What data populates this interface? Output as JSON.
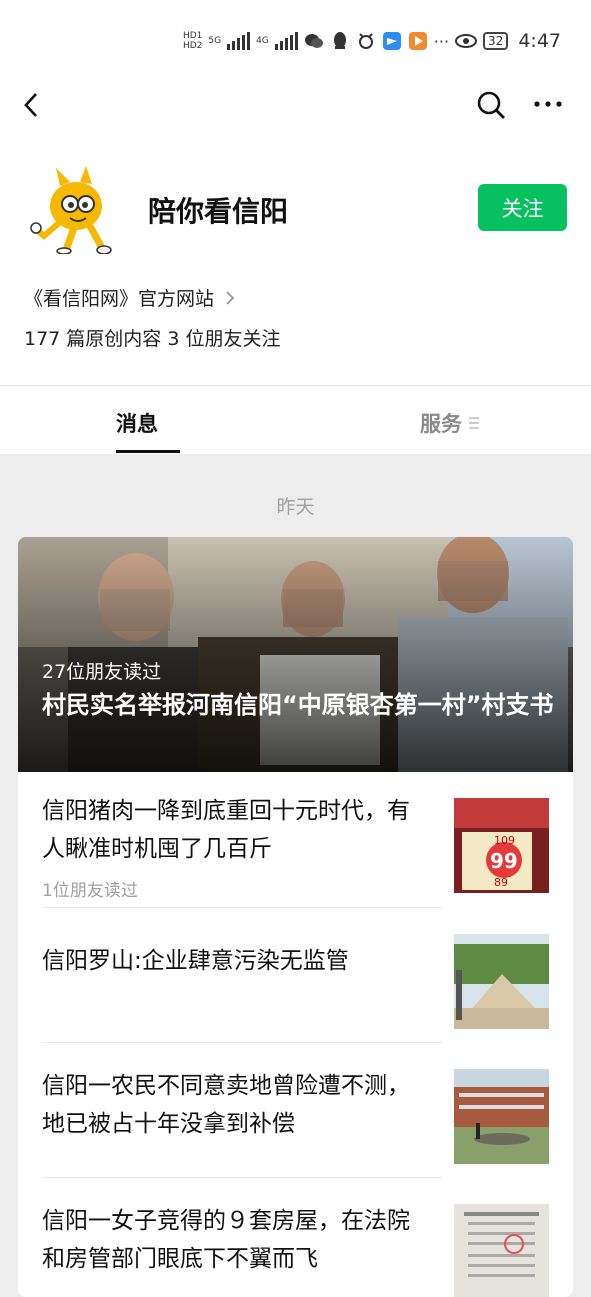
{
  "status_bar": {
    "hd1": "HD1",
    "hd2": "HD2",
    "net1": "5G",
    "net2": "4G",
    "battery": "32",
    "time": "4:47"
  },
  "nav": {
    "back_icon": "chevron-left-icon",
    "search_icon": "search-icon",
    "more_icon": "more-icon"
  },
  "account": {
    "name": "陪你看信阳",
    "follow_label": "关注",
    "description": "《看信阳网》官方网站",
    "stats": "177 篇原创内容  3 位朋友关注"
  },
  "tabs": [
    {
      "label": "消息",
      "active": true
    },
    {
      "label": "服务",
      "active": false
    }
  ],
  "feed": {
    "date_label": "昨天",
    "hero": {
      "read_by": "27位朋友读过",
      "title": "村民实名举报河南信阳“中原银杏第一村”村支书"
    },
    "items": [
      {
        "title": "信阳猪肉一降到底重回十元时代，有人瞅准时机囤了几百斤",
        "sub": "1位朋友读过"
      },
      {
        "title": "信阳罗山:企业肆意污染无监管",
        "sub": ""
      },
      {
        "title": "信阳一农民不同意卖地曾险遭不测，地已被占十年没拿到补偿",
        "sub": ""
      },
      {
        "title": "信阳一女子竞得的９套房屋，在法院和房管部门眼底下不翼而飞",
        "sub": ""
      }
    ],
    "thumb_text": {
      "price1": "109",
      "price2": "99",
      "price3": "89"
    }
  },
  "colors": {
    "accent": "#07c160",
    "bg": "#ededed"
  }
}
